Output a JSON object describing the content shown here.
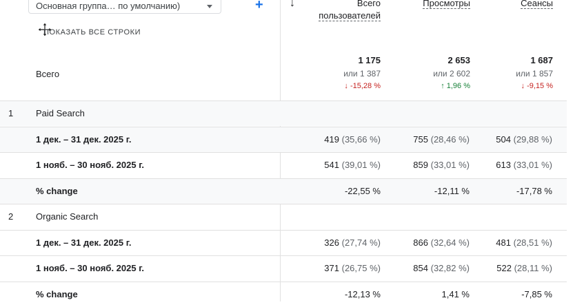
{
  "header": {
    "dimension_select": "Основная группа… по умолчанию)",
    "show_all_rows": "ПОКАЗАТЬ ВСЕ СТРОКИ",
    "columns": [
      {
        "line1": "Всего",
        "line2": "пользователей"
      },
      {
        "line1": "Просмотры",
        "line2": ""
      },
      {
        "line1": "Сеансы",
        "line2": ""
      }
    ]
  },
  "totals": {
    "label": "Всего",
    "values": [
      {
        "value": "1 175",
        "compare": "или 1 387",
        "delta": "-15,28 %",
        "dir": "down"
      },
      {
        "value": "2 653",
        "compare": "или 2 602",
        "delta": "1,96 %",
        "dir": "up"
      },
      {
        "value": "1 687",
        "compare": "или 1 857",
        "delta": "-9,15 %",
        "dir": "down"
      }
    ]
  },
  "rows": [
    {
      "num": "1",
      "name": "Paid Search",
      "bold": false,
      "cells": [
        "",
        "",
        ""
      ],
      "pct": [
        "",
        "",
        ""
      ]
    },
    {
      "num": "",
      "name": "1 дек. – 31 дек. 2025 г.",
      "bold": true,
      "cells": [
        "419",
        "755",
        "504"
      ],
      "pct": [
        "(35,66 %)",
        "(28,46 %)",
        "(29,88 %)"
      ]
    },
    {
      "num": "",
      "name": "1 нояб. – 30 нояб. 2025 г.",
      "bold": true,
      "cells": [
        "541",
        "859",
        "613"
      ],
      "pct": [
        "(39,01 %)",
        "(33,01 %)",
        "(33,01 %)"
      ]
    },
    {
      "num": "",
      "name": "% change",
      "bold": true,
      "cells": [
        "-22,55 %",
        "-12,11 %",
        "-17,78 %"
      ],
      "pct": [
        "",
        "",
        ""
      ]
    },
    {
      "num": "2",
      "name": "Organic Search",
      "bold": false,
      "cells": [
        "",
        "",
        ""
      ],
      "pct": [
        "",
        "",
        ""
      ]
    },
    {
      "num": "",
      "name": "1 дек. – 31 дек. 2025 г.",
      "bold": true,
      "cells": [
        "326",
        "866",
        "481"
      ],
      "pct": [
        "(27,74 %)",
        "(32,64 %)",
        "(28,51 %)"
      ]
    },
    {
      "num": "",
      "name": "1 нояб. – 30 нояб. 2025 г.",
      "bold": true,
      "cells": [
        "371",
        "854",
        "522"
      ],
      "pct": [
        "(26,75 %)",
        "(32,82 %)",
        "(28,11 %)"
      ]
    },
    {
      "num": "",
      "name": "% change",
      "bold": true,
      "cells": [
        "-12,13 %",
        "1,41 %",
        "-7,85 %"
      ],
      "pct": [
        "",
        "",
        ""
      ]
    }
  ]
}
